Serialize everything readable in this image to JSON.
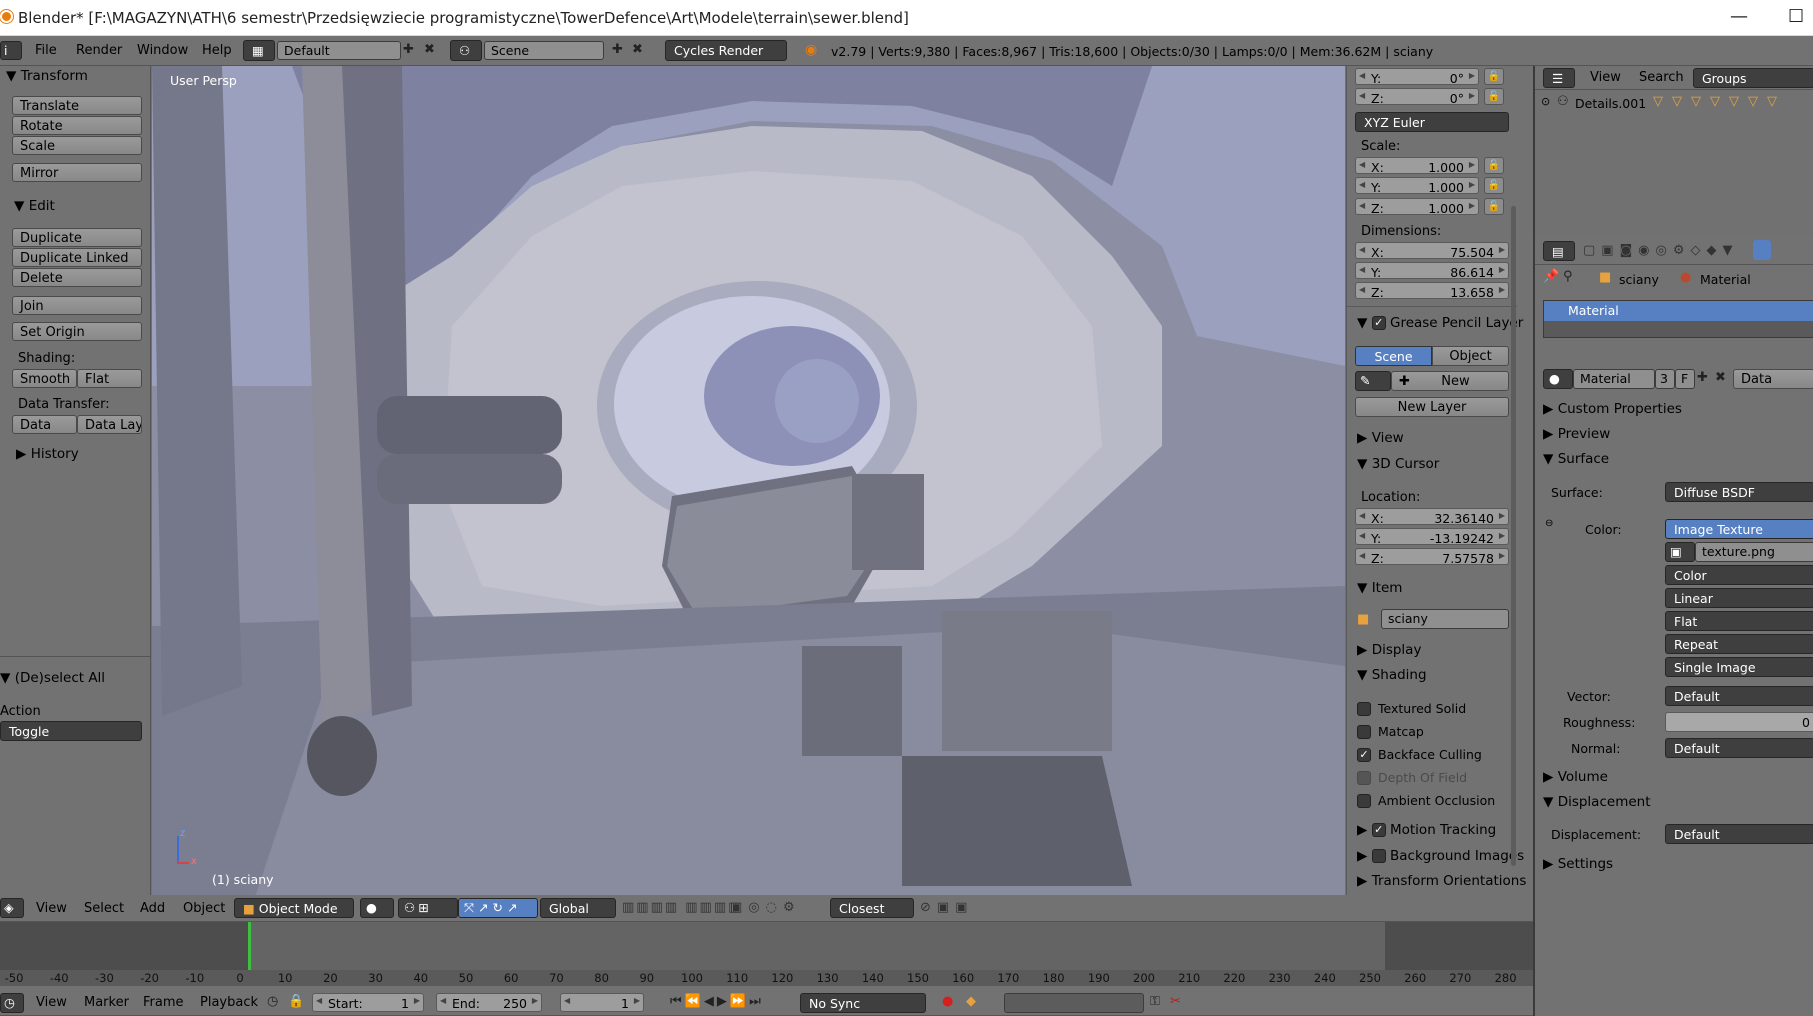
{
  "window": {
    "title": "Blender* [F:\\MAGAZYN\\ATH\\6 semestr\\Przedsięwziecie programistyczne\\TowerDefence\\Art\\Modele\\terrain\\sewer.blend]",
    "minimize": "—",
    "maximize": "☐"
  },
  "info_header": {
    "menus": [
      "File",
      "Render",
      "Window",
      "Help"
    ],
    "screen": "Default",
    "scene": "Scene",
    "engine": "Cycles Render",
    "stats": "v2.79 | Verts:9,380 | Faces:8,967 | Tris:18,600 | Objects:0/30 | Lamps:0/0 | Mem:36.62M | sciany"
  },
  "toolshelf": {
    "transform_title": "Transform",
    "translate": "Translate",
    "rotate": "Rotate",
    "scale": "Scale",
    "mirror": "Mirror",
    "edit_title": "Edit",
    "duplicate": "Duplicate",
    "duplicate_linked": "Duplicate Linked",
    "delete": "Delete",
    "join": "Join",
    "set_origin": "Set Origin",
    "shading_label": "Shading:",
    "smooth": "Smooth",
    "flat": "Flat",
    "data_transfer_label": "Data Transfer:",
    "data": "Data",
    "data_layout": "Data Layo",
    "history": "History",
    "deselect_all": "(De)select All",
    "action_label": "Action",
    "action_value": "Toggle"
  },
  "viewport": {
    "view_label": "User Persp",
    "object_label": "(1) sciany",
    "axis_z": "z",
    "axis_x": "x",
    "axis_y": "y"
  },
  "npanel": {
    "rot_y_label": "Y:",
    "rot_y": "0°",
    "rot_z_label": "Z:",
    "rot_z": "0°",
    "rot_mode": "XYZ Euler",
    "scale_label": "Scale:",
    "scale_x": "1.000",
    "scale_y": "1.000",
    "scale_z": "1.000",
    "dimensions_label": "Dimensions:",
    "dim_x": "75.504",
    "dim_y": "86.614",
    "dim_z": "13.658",
    "x": "X:",
    "y": "Y:",
    "z": "Z:",
    "grease_pencil": "Grease Pencil Layer",
    "scene_btn": "Scene",
    "object_btn": "Object",
    "new_btn": "New",
    "new_layer": "New Layer",
    "view": "View",
    "cursor": "3D Cursor",
    "location_label": "Location:",
    "cur_x": "32.36140",
    "cur_y": "-13.19242",
    "cur_z": "7.57578",
    "item": "Item",
    "item_name": "sciany",
    "display": "Display",
    "shading": "Shading",
    "textured_solid": "Textured Solid",
    "matcap": "Matcap",
    "backface_culling": "Backface Culling",
    "depth_of_field": "Depth Of Field",
    "ambient_occlusion": "Ambient Occlusion",
    "motion_tracking": "Motion Tracking",
    "background_images": "Background Images",
    "transform_orientations": "Transform Orientations"
  },
  "outliner": {
    "view": "View",
    "search": "Search",
    "groups": "Groups",
    "item": "Details.001"
  },
  "properties": {
    "breadcrumb_obj": "sciany",
    "breadcrumb_mat": "Material",
    "slot": "Material",
    "mat_name": "Material",
    "users": "3",
    "fake": "F",
    "data_btn": "Data",
    "custom_properties": "Custom Properties",
    "preview": "Preview",
    "surface": "Surface",
    "surface_label": "Surface:",
    "surface_value": "Diffuse BSDF",
    "color_label": "Color:",
    "color_value": "Image Texture",
    "texture": "texture.png",
    "opt1": "Color",
    "opt2": "Linear",
    "opt3": "Flat",
    "opt4": "Repeat",
    "opt5": "Single Image",
    "vector_label": "Vector:",
    "vector_value": "Default",
    "roughness_label": "Roughness:",
    "roughness_value": "0",
    "normal_label": "Normal:",
    "normal_value": "Default",
    "volume": "Volume",
    "displacement": "Displacement",
    "displacement_label": "Displacement:",
    "displacement_value": "Default",
    "settings": "Settings"
  },
  "view3d_header": {
    "menus": [
      "View",
      "Select",
      "Add",
      "Object"
    ],
    "mode": "Object Mode",
    "orientation": "Global",
    "snap": "Closest"
  },
  "timeline": {
    "ticks": [
      "-50",
      "-40",
      "-30",
      "-20",
      "-10",
      "0",
      "10",
      "20",
      "30",
      "40",
      "50",
      "60",
      "70",
      "80",
      "90",
      "100",
      "110",
      "120",
      "130",
      "140",
      "150",
      "160",
      "170",
      "180",
      "190",
      "200",
      "210",
      "220",
      "230",
      "240",
      "250",
      "260",
      "270",
      "280"
    ],
    "menus": [
      "View",
      "Marker",
      "Frame",
      "Playback"
    ],
    "start_label": "Start:",
    "start": "1",
    "end_label": "End:",
    "end": "250",
    "current": "1",
    "sync": "No Sync"
  }
}
